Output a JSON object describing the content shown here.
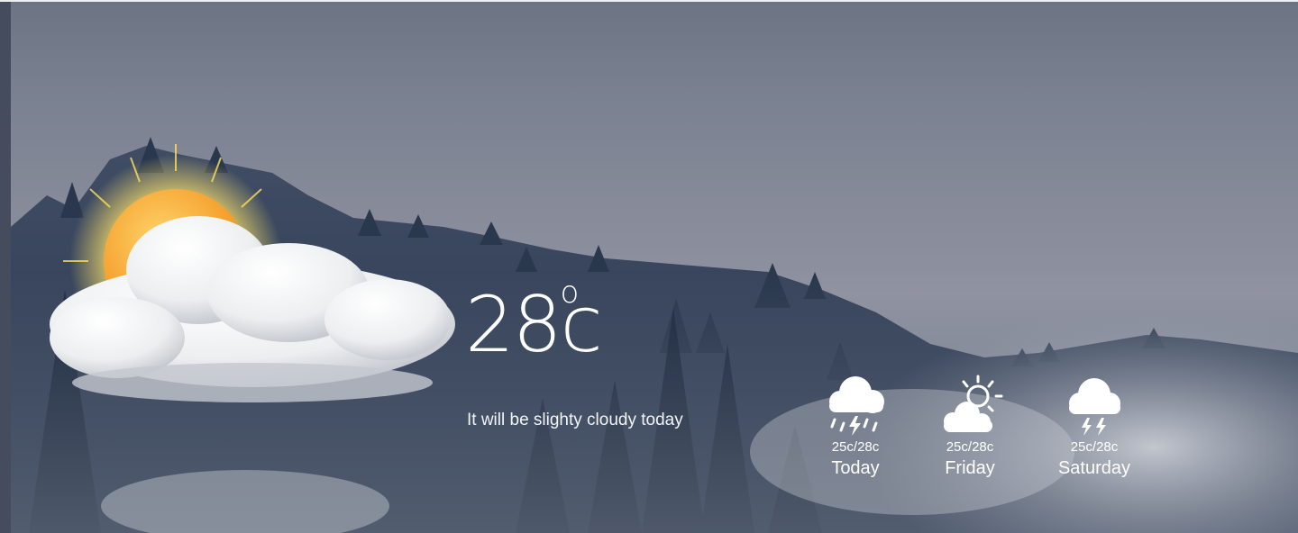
{
  "current": {
    "temperature": "28",
    "degree_symbol": "o",
    "unit": "c",
    "description": "It will be slighty cloudy today",
    "icon": "partly-cloudy-sun-icon"
  },
  "forecast": [
    {
      "icon": "rain-thunder-cloud-icon",
      "range": "25c/28c",
      "day": "Today"
    },
    {
      "icon": "partly-sunny-cloud-icon",
      "range": "25c/28c",
      "day": "Friday"
    },
    {
      "icon": "thunder-cloud-icon",
      "range": "25c/28c",
      "day": "Saturday"
    }
  ],
  "colors": {
    "text": "#ffffff",
    "sky": "#868a99",
    "forest": "#2c3b52",
    "sun": "#f6a623"
  }
}
